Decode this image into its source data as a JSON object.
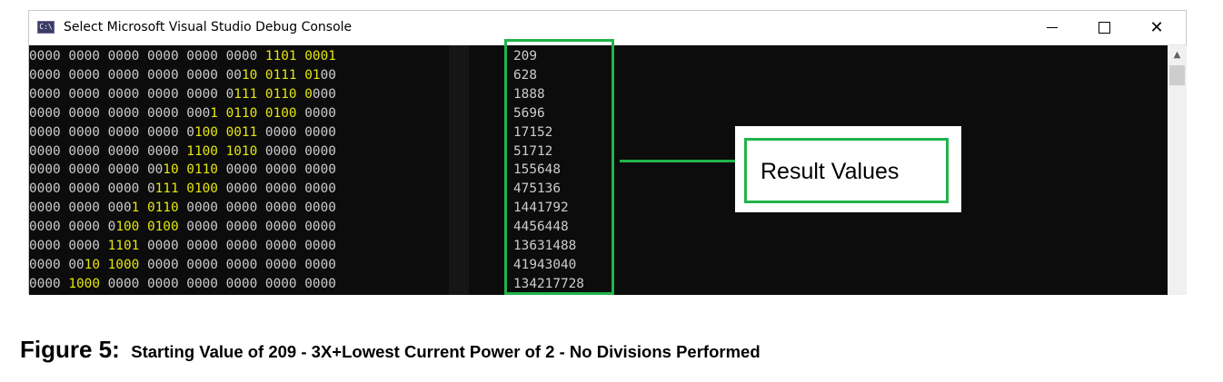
{
  "window": {
    "title": "Select Microsoft Visual Studio Debug Console",
    "icon": "console-app-icon",
    "icon_glyph": "C:\\",
    "controls": {
      "minimize": "minimize-icon",
      "maximize": "maximize-icon",
      "close": "close-icon"
    }
  },
  "console": {
    "binary_rows": [
      [
        [
          "0000 0000 0000 0000 0000 0000 ",
          false
        ],
        [
          "1101 0001",
          true
        ]
      ],
      [
        [
          "0000 0000 0000 0000 0000 00",
          false
        ],
        [
          "10 0111 01",
          true
        ],
        [
          "00",
          false
        ]
      ],
      [
        [
          "0000 0000 0000 0000 0000 0",
          false
        ],
        [
          "111 0110 0",
          true
        ],
        [
          "000",
          false
        ]
      ],
      [
        [
          "0000 0000 0000 0000 000",
          false
        ],
        [
          "1 0110 0100",
          true
        ],
        [
          " 0000",
          false
        ]
      ],
      [
        [
          "0000 0000 0000 0000 0",
          false
        ],
        [
          "100 0011",
          true
        ],
        [
          " 0000 0000",
          false
        ]
      ],
      [
        [
          "0000 0000 0000 0000 ",
          false
        ],
        [
          "1100 1010",
          true
        ],
        [
          " 0000 0000",
          false
        ]
      ],
      [
        [
          "0000 0000 0000 00",
          false
        ],
        [
          "10 0110",
          true
        ],
        [
          " 0000 0000 0000",
          false
        ]
      ],
      [
        [
          "0000 0000 0000 0",
          false
        ],
        [
          "111 0100",
          true
        ],
        [
          " 0000 0000 0000",
          false
        ]
      ],
      [
        [
          "0000 0000 000",
          false
        ],
        [
          "1 0110",
          true
        ],
        [
          " 0000 0000 0000 0000",
          false
        ]
      ],
      [
        [
          "0000 0000 0",
          false
        ],
        [
          "100 0100",
          true
        ],
        [
          " 0000 0000 0000 0000",
          false
        ]
      ],
      [
        [
          "0000 0000 ",
          false
        ],
        [
          "1101",
          true
        ],
        [
          " 0000 0000 0000 0000 0000",
          false
        ]
      ],
      [
        [
          "0000 00",
          false
        ],
        [
          "10 1000",
          true
        ],
        [
          " 0000 0000 0000 0000 0000",
          false
        ]
      ],
      [
        [
          "0000 ",
          false
        ],
        [
          "1000",
          true
        ],
        [
          " 0000 0000 0000 0000 0000 0000",
          false
        ]
      ]
    ],
    "decimal_values": [
      "209",
      "628",
      "1888",
      "5696",
      "17152",
      "51712",
      "155648",
      "475136",
      "1441792",
      "4456448",
      "13631488",
      "41943040",
      "134217728"
    ]
  },
  "annotation": {
    "callout_label": "Result Values",
    "color": "#21b34a"
  },
  "caption": {
    "figure": "Figure 5:",
    "text": "Starting Value of 209 - 3X+Lowest Current Power of 2 - No Divisions Performed"
  },
  "colors": {
    "console_bg": "#0c0c0c",
    "text": "#cccccc",
    "highlight": "#e5e510",
    "accent": "#21b34a"
  }
}
